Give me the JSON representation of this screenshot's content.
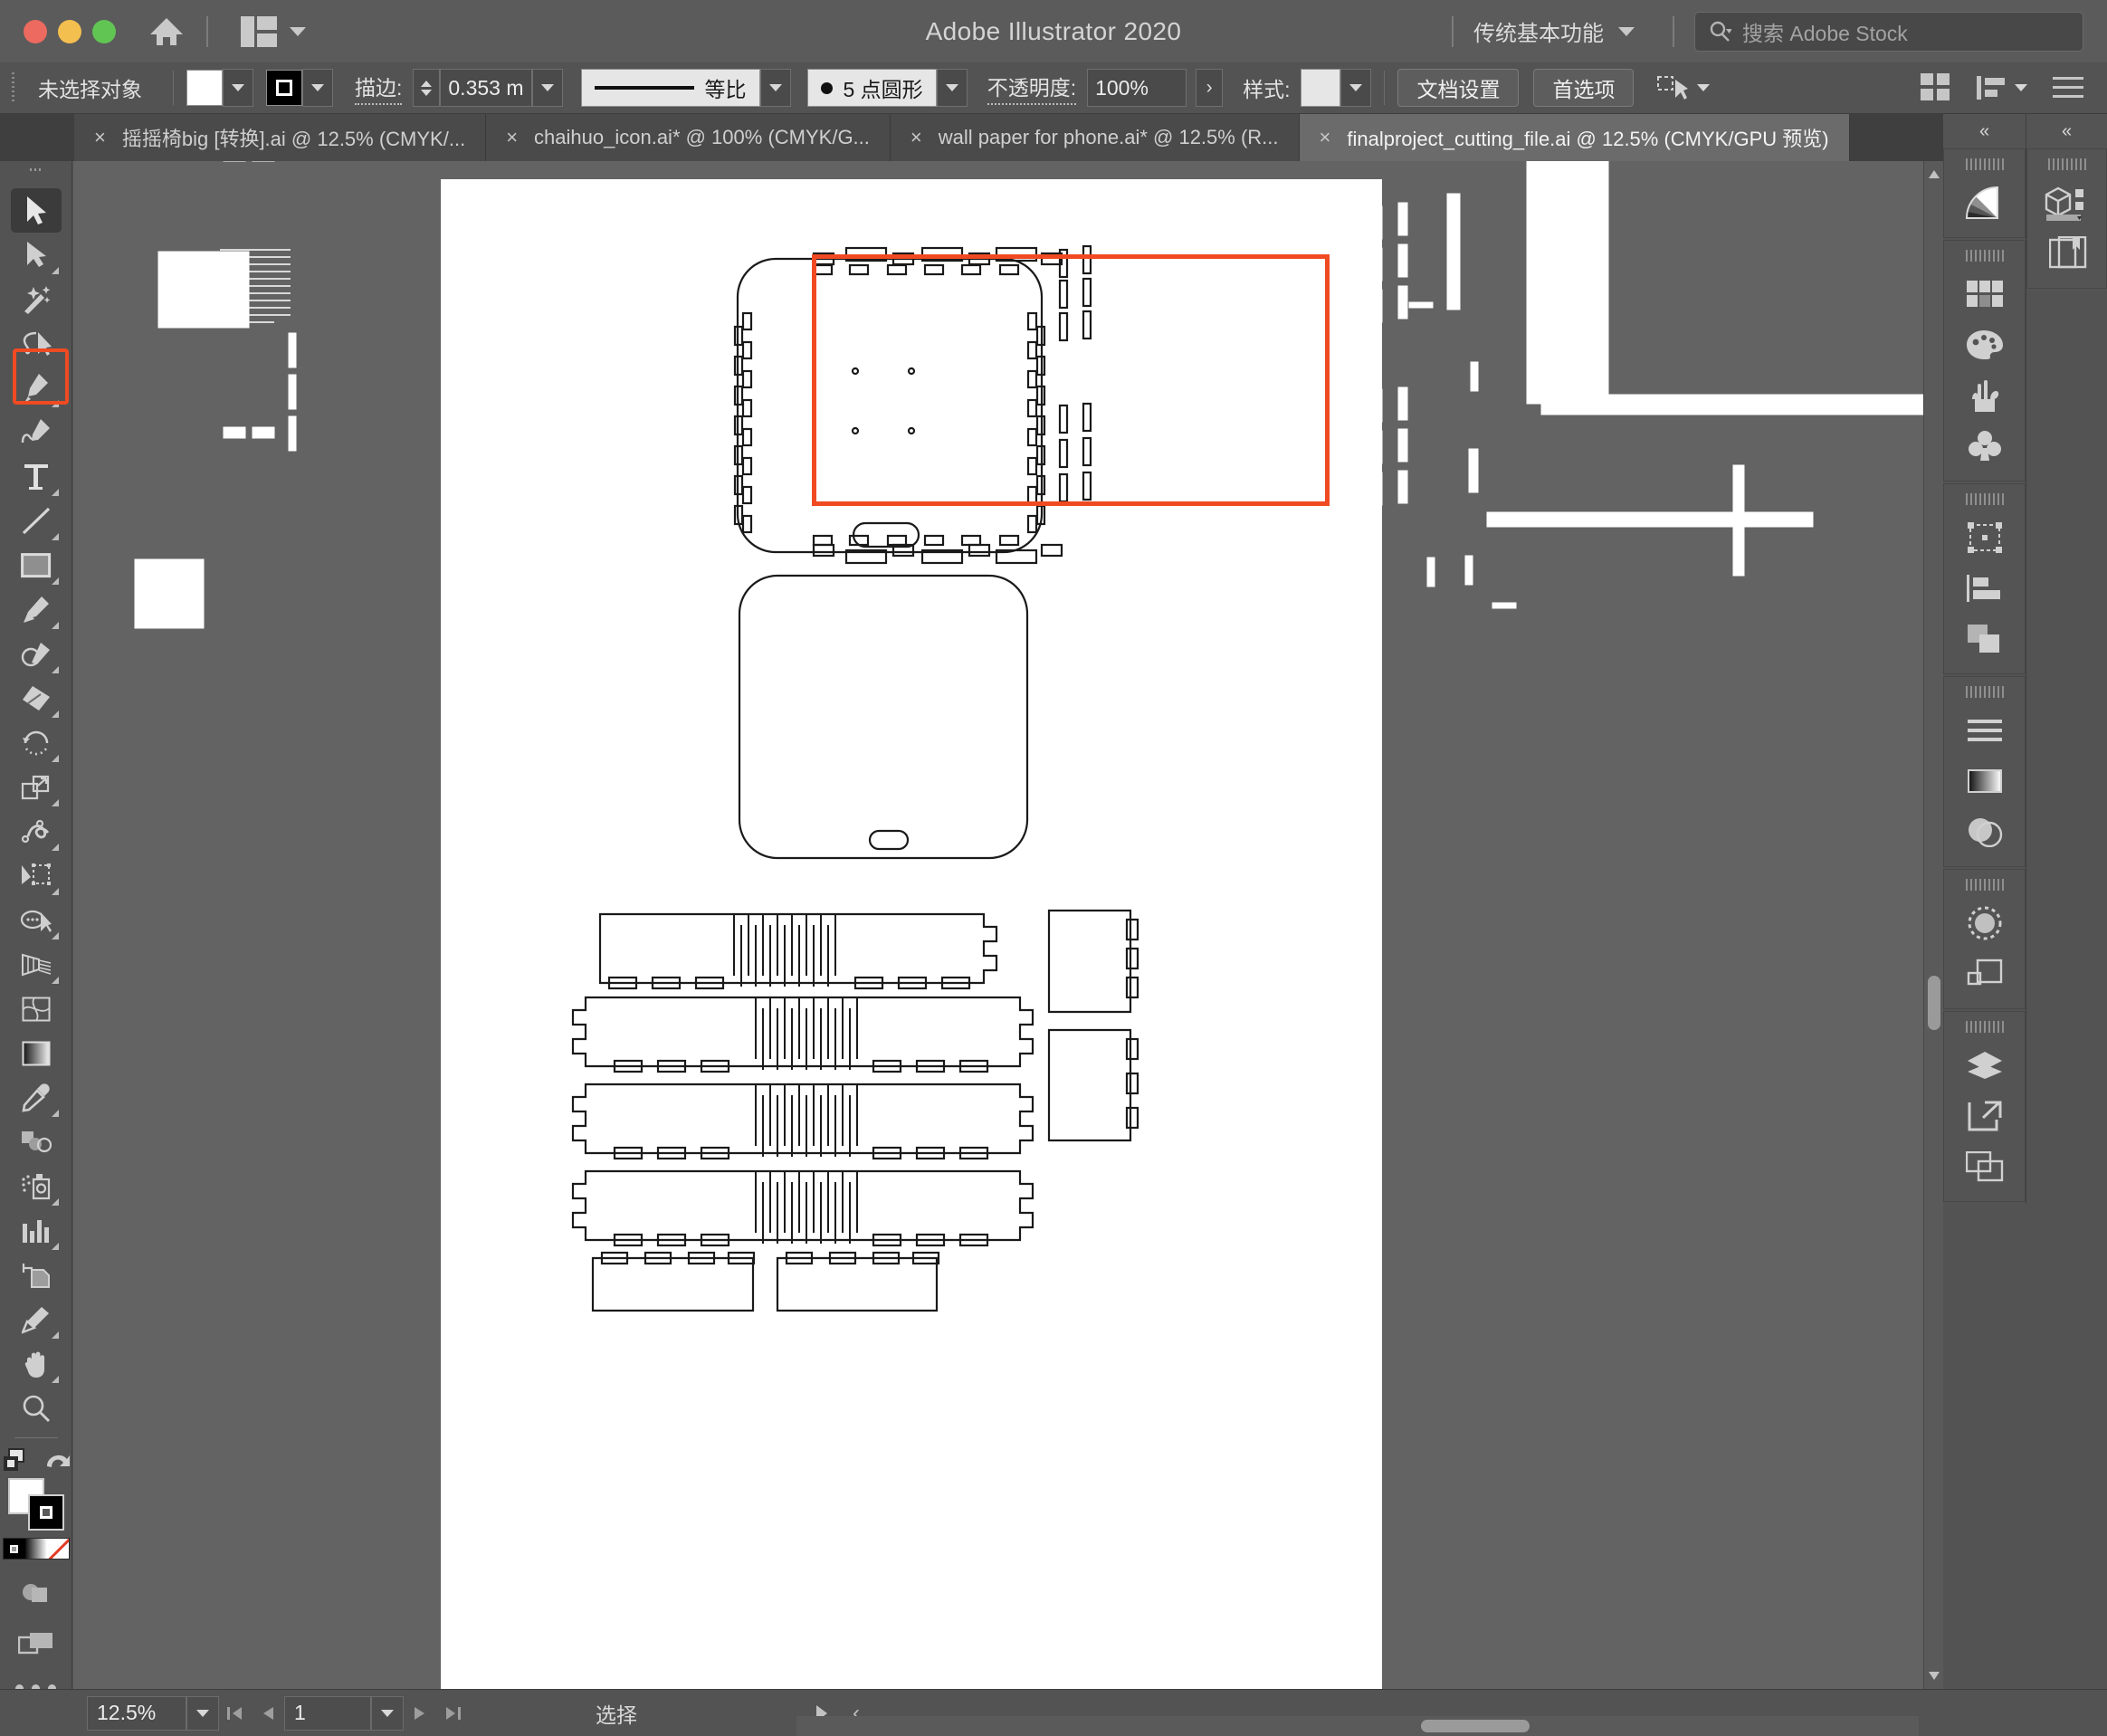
{
  "titlebar": {
    "app_title": "Adobe Illustrator 2020",
    "workspace_name": "传统基本功能",
    "search_placeholder": "搜索 Adobe Stock",
    "home_icon": "home-icon",
    "arrange_icon": "arrange-documents-icon",
    "search_icon": "search-icon"
  },
  "controlbar": {
    "selection_status": "未选择对象",
    "fill_color": "#ffffff",
    "stroke_color": "#000000",
    "stroke_label": "描边:",
    "stroke_weight": "0.353 m",
    "variable_width_profile": "等比",
    "brush_definition": "5 点圆形",
    "opacity_label": "不透明度:",
    "opacity_value": "100%",
    "style_label": "样式:",
    "style_swatch": "#e6e6e6",
    "document_setup_button": "文档设置",
    "preferences_button": "首选项",
    "align_icon": "align-to-selection-icon",
    "grid_icon": "grid-view-icon",
    "arrange_icon": "arrange-objects-icon",
    "menu_icon": "options-menu-icon"
  },
  "tabs": [
    {
      "label": "摇摇椅big [转换].ai @ 12.5% (CMYK/...",
      "active": false,
      "close": "×"
    },
    {
      "label": "chaihuo_icon.ai* @ 100% (CMYK/G...",
      "active": false,
      "close": "×"
    },
    {
      "label": "wall paper for phone.ai* @ 12.5% (R...",
      "active": false,
      "close": "×"
    },
    {
      "label": "finalproject_cutting_file.ai @ 12.5% (CMYK/GPU 预览)",
      "active": true,
      "close": "×"
    }
  ],
  "toolbar": {
    "tools": [
      {
        "name": "selection-tool",
        "selected": true,
        "corner": false
      },
      {
        "name": "direct-selection-tool",
        "selected": false,
        "corner": true
      },
      {
        "name": "magic-wand-tool",
        "selected": false,
        "corner": false
      },
      {
        "name": "lasso-tool",
        "selected": false,
        "corner": false
      },
      {
        "name": "pen-tool",
        "selected": false,
        "corner": true
      },
      {
        "name": "curvature-tool",
        "selected": false,
        "corner": false
      },
      {
        "name": "type-tool",
        "selected": false,
        "corner": true
      },
      {
        "name": "line-segment-tool",
        "selected": false,
        "corner": true
      },
      {
        "name": "rectangle-tool",
        "selected": false,
        "corner": true,
        "highlighted": true
      },
      {
        "name": "paintbrush-tool",
        "selected": false,
        "corner": true
      },
      {
        "name": "shaper-tool",
        "selected": false,
        "corner": true
      },
      {
        "name": "eraser-tool",
        "selected": false,
        "corner": true
      },
      {
        "name": "rotate-tool",
        "selected": false,
        "corner": true
      },
      {
        "name": "scale-tool",
        "selected": false,
        "corner": true
      },
      {
        "name": "width-tool",
        "selected": false,
        "corner": true
      },
      {
        "name": "free-transform-tool",
        "selected": false,
        "corner": true
      },
      {
        "name": "shape-builder-tool",
        "selected": false,
        "corner": true
      },
      {
        "name": "perspective-grid-tool",
        "selected": false,
        "corner": true
      },
      {
        "name": "mesh-tool",
        "selected": false,
        "corner": false
      },
      {
        "name": "gradient-tool",
        "selected": false,
        "corner": false
      },
      {
        "name": "eyedropper-tool",
        "selected": false,
        "corner": true
      },
      {
        "name": "blend-tool",
        "selected": false,
        "corner": false
      },
      {
        "name": "symbol-sprayer-tool",
        "selected": false,
        "corner": true
      },
      {
        "name": "column-graph-tool",
        "selected": false,
        "corner": true
      },
      {
        "name": "artboard-tool",
        "selected": false,
        "corner": false
      },
      {
        "name": "slice-tool",
        "selected": false,
        "corner": true
      },
      {
        "name": "hand-tool",
        "selected": false,
        "corner": true
      },
      {
        "name": "zoom-tool",
        "selected": false,
        "corner": false
      }
    ],
    "edit_toolbar_icon": "edit-toolbar-icon",
    "undo_icon": "undo-arrow-icon",
    "fill_swatch": "#ffffff",
    "stroke_swatch": "#000000",
    "color_modes": [
      "color-swatch-mode",
      "gradient-mode",
      "none-mode"
    ],
    "drawing_mode_icon": "drawing-mode-icon",
    "screen_mode_icon": "screen-mode-icon",
    "more_icon": "more-tools-icon"
  },
  "right_panel": {
    "collapse_label": "«",
    "column_a_groups": [
      {
        "icons": [
          "gradient-panel-icon"
        ]
      },
      {
        "icons": [
          "swatches-panel-icon",
          "color-panel-icon",
          "brushes-panel-icon",
          "symbols-panel-icon"
        ]
      },
      {
        "icons": [
          "transform-panel-icon",
          "align-panel-icon",
          "pathfinder-panel-icon"
        ]
      },
      {
        "icons": [
          "paragraph-panel-icon",
          "gradient-bar-icon",
          "transparency-panel-icon"
        ]
      },
      {
        "icons": [
          "appearance-panel-icon",
          "graphic-styles-icon"
        ]
      },
      {
        "icons": [
          "layers-panel-icon",
          "links-panel-icon",
          "artboards-panel-icon"
        ]
      }
    ],
    "column_b_groups": [
      {
        "icons": [
          "3d-panel-icon",
          "libraries-panel-icon"
        ]
      }
    ]
  },
  "statusbar": {
    "zoom_level": "12.5%",
    "page_number": "1",
    "status_text": "选择",
    "first_page_icon": "first-page-icon",
    "prev_page_icon": "prev-page-icon",
    "next_page_icon": "next-page-icon",
    "last_page_icon": "last-page-icon"
  },
  "canvas": {
    "document_name": "finalproject_cutting_file.ai",
    "zoom": "12.5%",
    "highlight_color": "#f04a23",
    "artwork_description": "laser cutting file with rounded-square panels, finger joints and living-hinge slot arrays"
  }
}
